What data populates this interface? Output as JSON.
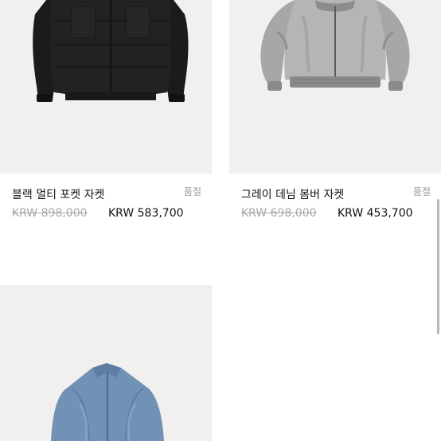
{
  "products": [
    {
      "name": "블랙 멀티 포켓 자켓",
      "status": "품절",
      "original_price": "KRW 898,000",
      "sale_price": "KRW 583,700",
      "image_icon": "black-jacket-image"
    },
    {
      "name": "그레이 데님 봄버 자켓",
      "status": "품절",
      "original_price": "KRW 698,000",
      "sale_price": "KRW 453,700",
      "image_icon": "grey-denim-bomber-image"
    },
    {
      "name": "",
      "status": "",
      "original_price": "",
      "sale_price": "",
      "image_icon": "blue-denim-jacket-image"
    }
  ],
  "colors": {
    "image_background": "#f1f0ef",
    "strikethrough_text": "#a8a8a8",
    "soldout_text": "#9a9a9a",
    "black_jacket": "#1d1d1d",
    "grey_denim": "#a9a9a9",
    "blue_denim": "#6f8fb1"
  }
}
